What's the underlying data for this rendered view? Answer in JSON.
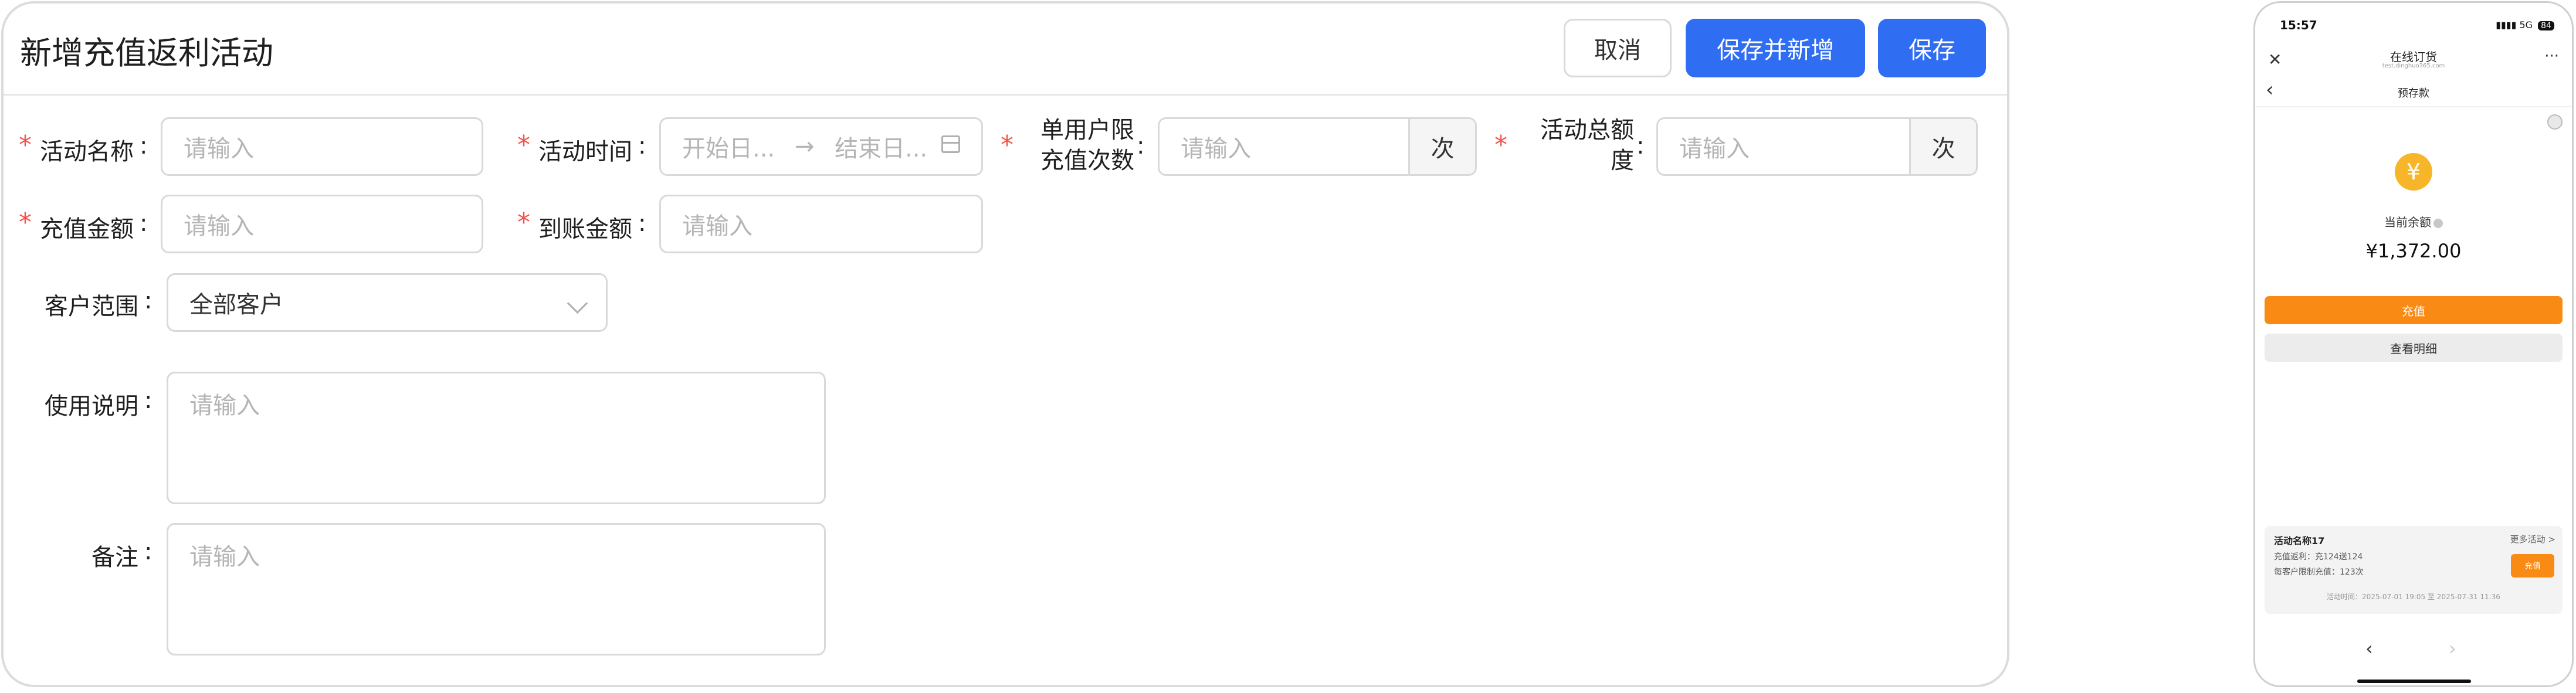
{
  "form": {
    "title": "新增充值返利活动",
    "buttons": {
      "cancel": "取消",
      "save_and_new": "保存并新增",
      "save": "保存"
    },
    "required_mark": "*",
    "fields": {
      "activity_name": {
        "label": "活动名称",
        "placeholder": "请输入"
      },
      "activity_time": {
        "label": "活动时间",
        "start_placeholder": "开始日...",
        "end_placeholder": "结束日...",
        "separator": "→"
      },
      "per_user_limit": {
        "label": "单用户限充值次数",
        "label_line1": "单用户限",
        "label_line2": "充值次数",
        "placeholder": "请输入",
        "unit": "次"
      },
      "total_limit": {
        "label": "活动总额度",
        "label_line1": "活动总额",
        "label_line2": "度",
        "placeholder": "请输入",
        "unit": "次"
      },
      "recharge_amount": {
        "label": "充值金额",
        "placeholder": "请输入"
      },
      "credited_amount": {
        "label": "到账金额",
        "placeholder": "请输入"
      },
      "customer_scope": {
        "label": "客户范围",
        "value": "全部客户"
      },
      "usage_note": {
        "label": "使用说明",
        "placeholder": "请输入"
      },
      "remark": {
        "label": "备注",
        "placeholder": "请输入"
      }
    },
    "colon": ":"
  },
  "phone": {
    "status": {
      "time": "15:57",
      "network": "5G",
      "battery": "84"
    },
    "miniapp": {
      "title": "在线订货",
      "url": "test.dinghuo365.com"
    },
    "page_title": "预存款",
    "balance_label": "当前余额",
    "balance_value": "¥1,372.00",
    "recharge_button": "充值",
    "detail_button": "查看明细",
    "promo": {
      "title": "活动名称17",
      "more": "更多活动 >",
      "line1": "充值返利：充124送124",
      "line2": "每客户限制充值：123次",
      "button": "充值",
      "time": "活动时间：2025-07-01 19:05 至 2025-07-31 11:36"
    },
    "icons": {
      "close": "close-icon",
      "more": "more-icon",
      "back": "back-icon",
      "coin": "yuan-coin-icon"
    },
    "colors": {
      "accent": "#f98a13",
      "coin": "#f7b52a"
    }
  },
  "colors": {
    "primary": "#2f6ef3",
    "required": "#f5514b",
    "border": "#d9d9d9",
    "placeholder": "#b5b5b5"
  }
}
